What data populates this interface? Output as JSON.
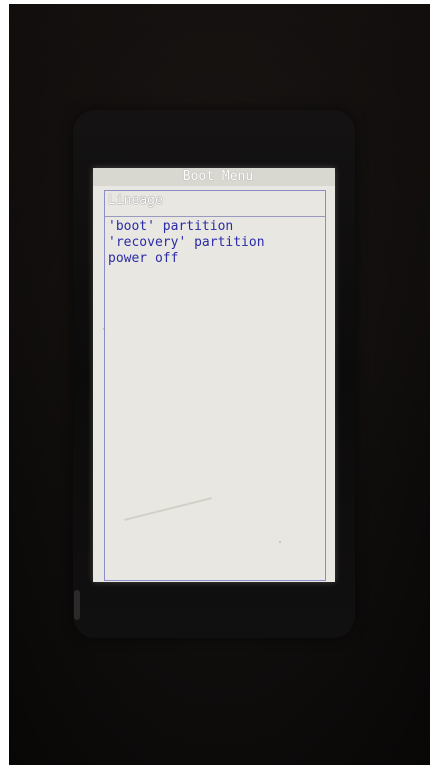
{
  "boot_menu": {
    "title": "Boot Menu",
    "header": "Lineage",
    "items": [
      {
        "label": "'boot' partition"
      },
      {
        "label": "'recovery' partition"
      },
      {
        "label": "power off"
      }
    ]
  },
  "colors": {
    "background": "#0f0d0c",
    "screen": "#e8e7e1",
    "menu_text": "#2b2ba8",
    "frame": "#8c8cc8",
    "header_text": "#ffffff"
  }
}
